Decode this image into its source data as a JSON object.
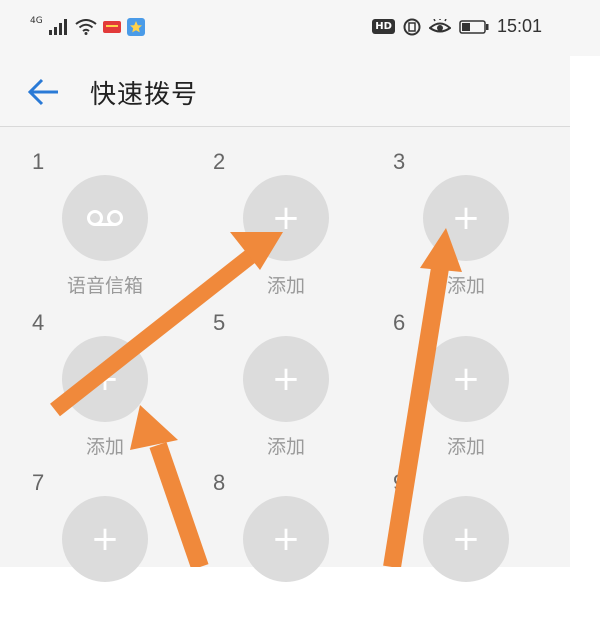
{
  "status_bar": {
    "network_label": "4G",
    "hd_label": "HD",
    "time": "15:01"
  },
  "app_bar": {
    "title": "快速拨号"
  },
  "speed_dial": [
    {
      "number": "1",
      "label": "语音信箱",
      "icon": "voicemail-icon"
    },
    {
      "number": "2",
      "label": "添加",
      "icon": "plus-icon"
    },
    {
      "number": "3",
      "label": "添加",
      "icon": "plus-icon"
    },
    {
      "number": "4",
      "label": "添加",
      "icon": "plus-icon"
    },
    {
      "number": "5",
      "label": "添加",
      "icon": "plus-icon"
    },
    {
      "number": "6",
      "label": "添加",
      "icon": "plus-icon"
    },
    {
      "number": "7",
      "label": "",
      "icon": "plus-icon"
    },
    {
      "number": "8",
      "label": "",
      "icon": "plus-icon"
    },
    {
      "number": "9",
      "label": "",
      "icon": "plus-icon"
    }
  ],
  "colors": {
    "accent": "#2a7ad6",
    "circle": "#dcdcdc",
    "arrow": "#f0893b"
  }
}
